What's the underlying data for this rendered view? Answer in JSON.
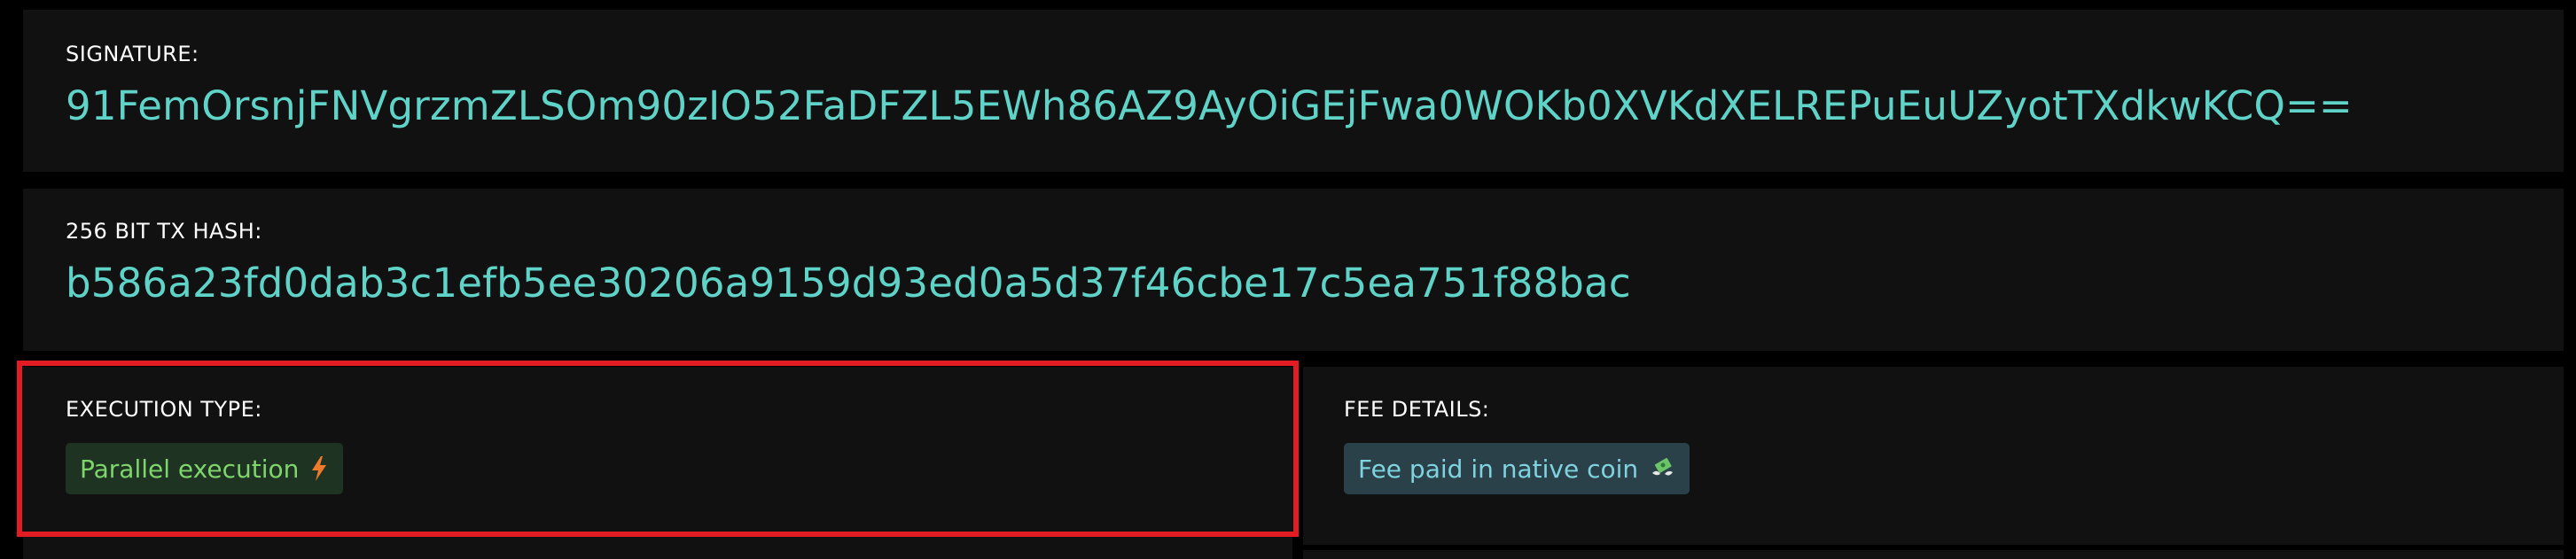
{
  "signature": {
    "label": "SIGNATURE:",
    "value": "91FemOrsnjFNVgrzmZLSOm90zIO52FaDFZL5EWh86AZ9AyOiGEjFwa0WOKb0XVKdXELREPuEuUZyotTXdkwKCQ=="
  },
  "tx_hash": {
    "label": "256 BIT TX HASH:",
    "value": "b586a23fd0dab3c1efb5ee30206a9159d93ed0a5d37f46cbe17c5ea751f88bac"
  },
  "execution": {
    "label": "EXECUTION TYPE:",
    "badge": "Parallel execution",
    "icon": "lightning-bolt-icon",
    "badge_color": "#7ed56b",
    "icon_color": "#f07a2c"
  },
  "fee": {
    "label": "FEE DETAILS:",
    "badge": "Fee paid in native coin",
    "icon": "flying-money-icon",
    "badge_color": "#7fd3df"
  },
  "highlight_color": "#e31b23"
}
